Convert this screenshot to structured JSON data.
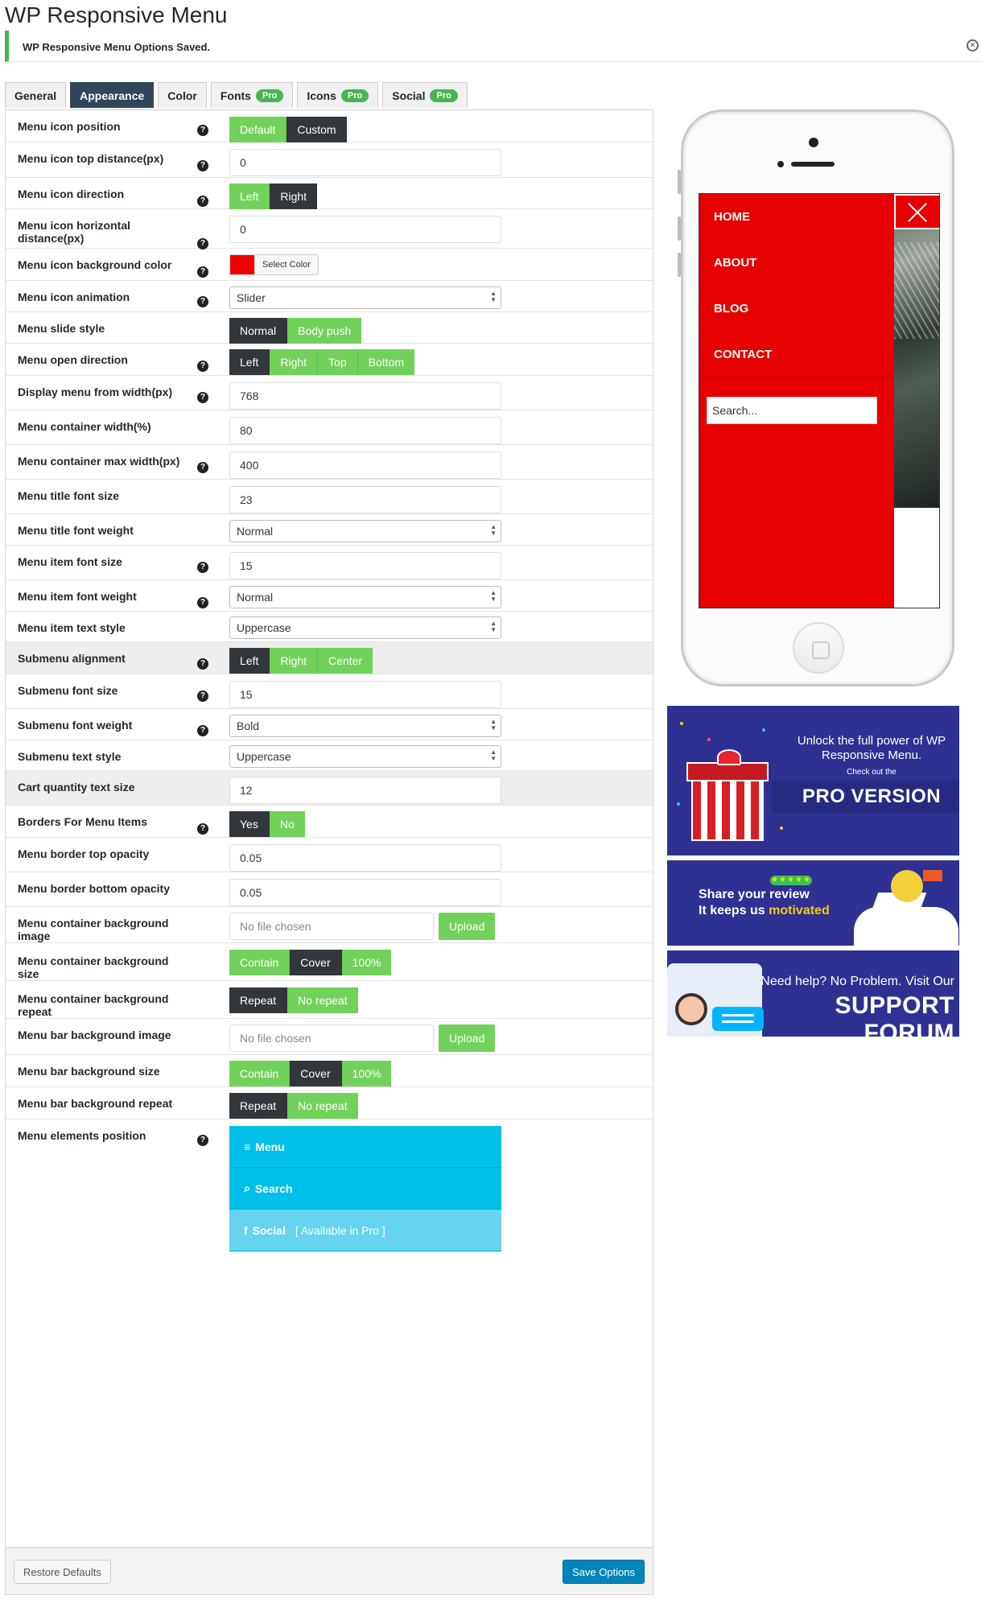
{
  "page": {
    "title": "WP Responsive Menu",
    "notice": "WP Responsive Menu Options Saved.",
    "dismiss_icon": "close-circle-icon"
  },
  "tabs": [
    {
      "label": "General",
      "pro": "",
      "active": false
    },
    {
      "label": "Appearance",
      "pro": "",
      "active": true
    },
    {
      "label": "Color",
      "pro": "",
      "active": false
    },
    {
      "label": "Fonts",
      "pro": "Pro",
      "active": false
    },
    {
      "label": "Icons",
      "pro": "Pro",
      "active": false
    },
    {
      "label": "Social",
      "pro": "Pro",
      "active": false
    }
  ],
  "help_icon": "?",
  "settings": {
    "menu_icon_position": {
      "label": "Menu icon position",
      "options": [
        "Default",
        "Custom"
      ],
      "selected": "Custom"
    },
    "menu_icon_top_distance": {
      "label": "Menu icon top distance(px)",
      "value": "0"
    },
    "menu_icon_direction": {
      "label": "Menu icon direction",
      "options": [
        "Left",
        "Right"
      ],
      "selected": "Right"
    },
    "menu_icon_horizontal_distance": {
      "label": "Menu icon horizontal distance(px)",
      "value": "0"
    },
    "menu_icon_background_color": {
      "label": "Menu icon background color",
      "button": "Select Color",
      "color": "#ee0000"
    },
    "menu_icon_animation": {
      "label": "Menu icon animation",
      "value": "Slider"
    },
    "menu_slide_style": {
      "label": "Menu slide style",
      "options": [
        "Normal",
        "Body push"
      ],
      "selected": "Normal"
    },
    "menu_open_direction": {
      "label": "Menu open direction",
      "options": [
        "Left",
        "Right",
        "Top",
        "Bottom"
      ],
      "selected": "Left"
    },
    "display_menu_from_width": {
      "label": "Display menu from width(px)",
      "value": "768"
    },
    "menu_container_width": {
      "label": "Menu container width(%)",
      "value": "80"
    },
    "menu_container_max_width": {
      "label": "Menu container max width(px)",
      "value": "400"
    },
    "menu_title_font_size": {
      "label": "Menu title font size",
      "value": "23"
    },
    "menu_title_font_weight": {
      "label": "Menu title font weight",
      "value": "Normal"
    },
    "menu_item_font_size": {
      "label": "Menu item font size",
      "value": "15"
    },
    "menu_item_font_weight": {
      "label": "Menu item font weight",
      "value": "Normal"
    },
    "menu_item_text_style": {
      "label": "Menu item text style",
      "value": "Uppercase"
    },
    "submenu_alignment": {
      "label": "Submenu alignment",
      "options": [
        "Left",
        "Right",
        "Center"
      ],
      "selected": "Left"
    },
    "submenu_font_size": {
      "label": "Submenu font size",
      "value": "15"
    },
    "submenu_font_weight": {
      "label": "Submenu font weight",
      "value": "Bold"
    },
    "submenu_text_style": {
      "label": "Submenu text style",
      "value": "Uppercase"
    },
    "cart_quantity_text_size": {
      "label": "Cart quantity text size",
      "value": "12"
    },
    "borders_for_menu_items": {
      "label": "Borders For Menu Items",
      "options": [
        "Yes",
        "No"
      ],
      "selected": "Yes"
    },
    "menu_border_top_opacity": {
      "label": "Menu border top opacity",
      "value": "0.05"
    },
    "menu_border_bottom_opacity": {
      "label": "Menu border bottom opacity",
      "value": "0.05"
    },
    "menu_container_background_image": {
      "label": "Menu container background image",
      "placeholder": "No file chosen",
      "button": "Upload"
    },
    "menu_container_background_size": {
      "label": "Menu container background size",
      "options": [
        "Contain",
        "Cover",
        "100%"
      ],
      "selected": "Cover"
    },
    "menu_container_background_repeat": {
      "label": "Menu container background repeat",
      "options": [
        "Repeat",
        "No repeat"
      ],
      "selected": "Repeat"
    },
    "menu_bar_background_image": {
      "label": "Menu bar background image",
      "placeholder": "No file chosen",
      "button": "Upload"
    },
    "menu_bar_background_size": {
      "label": "Menu bar background size",
      "options": [
        "Contain",
        "Cover",
        "100%"
      ],
      "selected": "Cover"
    },
    "menu_bar_background_repeat": {
      "label": "Menu bar background repeat",
      "options": [
        "Repeat",
        "No repeat"
      ],
      "selected": "Repeat"
    },
    "menu_elements_position": {
      "label": "Menu elements position",
      "items": [
        {
          "label": "Menu",
          "icon": "hamburger-icon",
          "glyph": "≡",
          "note": ""
        },
        {
          "label": "Search",
          "icon": "search-icon",
          "glyph": "⌕",
          "note": ""
        },
        {
          "label": "Social",
          "icon": "facebook-icon",
          "glyph": "f",
          "note": "[ Available in Pro ]"
        }
      ]
    }
  },
  "footer": {
    "restore_label": "Restore Defaults",
    "save_label": "Save Options"
  },
  "preview": {
    "menu_items": [
      "HOME",
      "ABOUT",
      "BLOG",
      "CONTACT"
    ],
    "search_placeholder": "Search...",
    "menu_color": "#e60000"
  },
  "banners": {
    "pro": {
      "line1": "Unlock the full power of WP Responsive Menu.",
      "line2": "Check out the",
      "line3": "PRO VERSION"
    },
    "review": {
      "stars": "★★★★★",
      "line1": "Share your review",
      "line2_prefix": "It keeps us ",
      "line2_highlight": "motivated"
    },
    "support": {
      "line1": "Need help? No Problem. Visit Our",
      "line2": "SUPPORT FORUM"
    }
  }
}
